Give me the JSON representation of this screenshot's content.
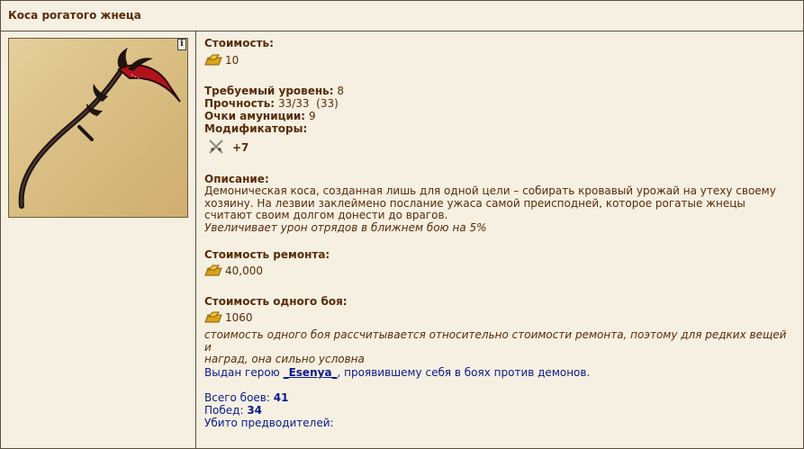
{
  "item": {
    "title": "Коса рогатого жнеца",
    "info_badge": "i",
    "cost_label": "Стоимость:",
    "cost_value": "10",
    "level_label": "Требуемый уровень:",
    "level_value": "8",
    "durability_label": "Прочность:",
    "durability_value": "33/33  (33)",
    "ammo_label": "Очки амуниции:",
    "ammo_value": "9",
    "modifiers_label": "Модификаторы:",
    "modifier_value": "+7",
    "description_label": "Описание:",
    "description_line1": "Демоническая коса, созданная лишь для одной цели – собирать кровавый урожай на утеху своему",
    "description_line2": "хозяину. На лезвии заклеймено послание ужаса самой преисподней, которое рогатые жнецы",
    "description_line3": "считают своим долгом донести до врагов.",
    "description_effect": "Увеличивает урон отрядов в ближнем бою на 5%",
    "repair_label": "Стоимость ремонта:",
    "repair_value": "40,000",
    "battle_cost_label": "Стоимость одного боя:",
    "battle_cost_value": "1060",
    "battle_note_line1": "стоимость одного боя рассчитывается относительно стоимости ремонта, поэтому для редких вещей и",
    "battle_note_line2": "наград, она сильно условна",
    "issued_prefix": "Выдан герою ",
    "hero_name": "_Esenya_",
    "issued_suffix": ", проявившему себя в боях против демонов.",
    "total_battles_label": "Всего боев: ",
    "total_battles_value": "41",
    "wins_label": "Побед: ",
    "wins_value": "34",
    "leaders_label": "Убито предводителей:"
  },
  "icons": {
    "gold": "gold-coins-icon",
    "modifier": "crossed-swords-icon",
    "info": "info-icon"
  },
  "colors": {
    "background": "#f5f0e1",
    "text": "#592c08",
    "link": "#0b1a8c",
    "border": "#5b4f41"
  }
}
